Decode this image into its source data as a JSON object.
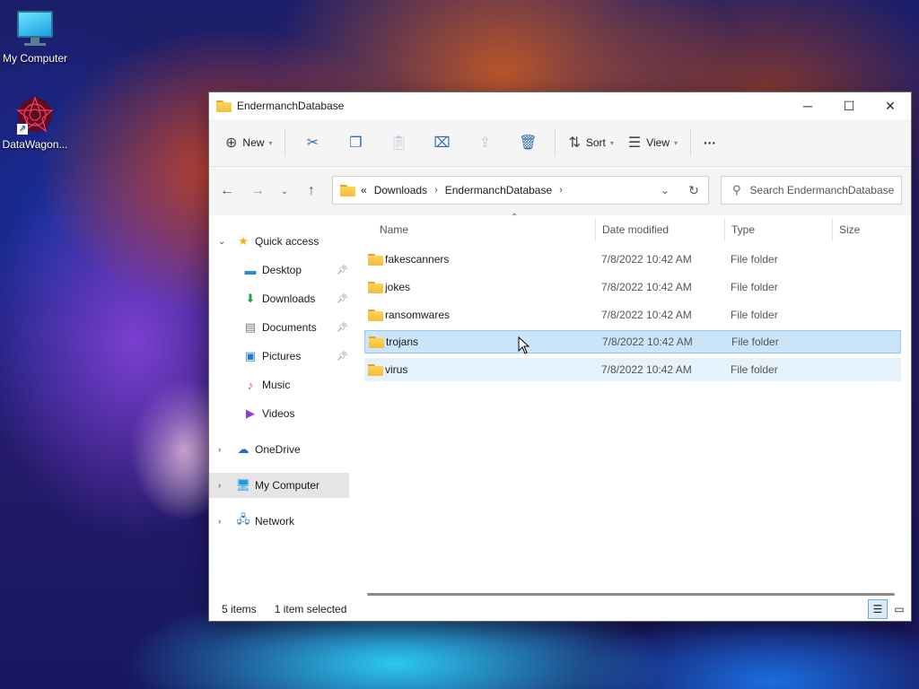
{
  "desktop": {
    "icons": [
      {
        "label": "My Computer",
        "icon": "computer-icon"
      },
      {
        "label": "DataWagon...",
        "icon": "datawagon-shortcut-icon"
      }
    ]
  },
  "window": {
    "title": "EndermanchDatabase",
    "controls": {
      "minimize": "─",
      "maximize": "☐",
      "close": "✕"
    }
  },
  "toolbar": {
    "new_label": "New",
    "sort_label": "Sort",
    "view_label": "View",
    "more_label": "···",
    "icons": [
      "cut-icon",
      "copy-icon",
      "paste-icon",
      "rename-icon",
      "share-icon",
      "delete-icon"
    ]
  },
  "address": {
    "overflow": "«",
    "crumbs": [
      "Downloads",
      "EndermanchDatabase"
    ],
    "search_placeholder": "Search EndermanchDatabase"
  },
  "nav": {
    "quick_access": "Quick access",
    "items": [
      {
        "label": "Desktop",
        "pinned": true
      },
      {
        "label": "Downloads",
        "pinned": true
      },
      {
        "label": "Documents",
        "pinned": true
      },
      {
        "label": "Pictures",
        "pinned": true
      },
      {
        "label": "Music",
        "pinned": false
      },
      {
        "label": "Videos",
        "pinned": false
      }
    ],
    "onedrive": "OneDrive",
    "my_computer": "My Computer",
    "network": "Network"
  },
  "columns": {
    "name": "Name",
    "date": "Date modified",
    "type": "Type",
    "size": "Size"
  },
  "files": [
    {
      "name": "fakescanners",
      "date": "7/8/2022 10:42 AM",
      "type": "File folder",
      "state": "normal"
    },
    {
      "name": "jokes",
      "date": "7/8/2022 10:42 AM",
      "type": "File folder",
      "state": "normal"
    },
    {
      "name": "ransomwares",
      "date": "7/8/2022 10:42 AM",
      "type": "File folder",
      "state": "normal"
    },
    {
      "name": "trojans",
      "date": "7/8/2022 10:42 AM",
      "type": "File folder",
      "state": "selected"
    },
    {
      "name": "virus",
      "date": "7/8/2022 10:42 AM",
      "type": "File folder",
      "state": "hover"
    }
  ],
  "status": {
    "count": "5 items",
    "selection": "1 item selected"
  }
}
